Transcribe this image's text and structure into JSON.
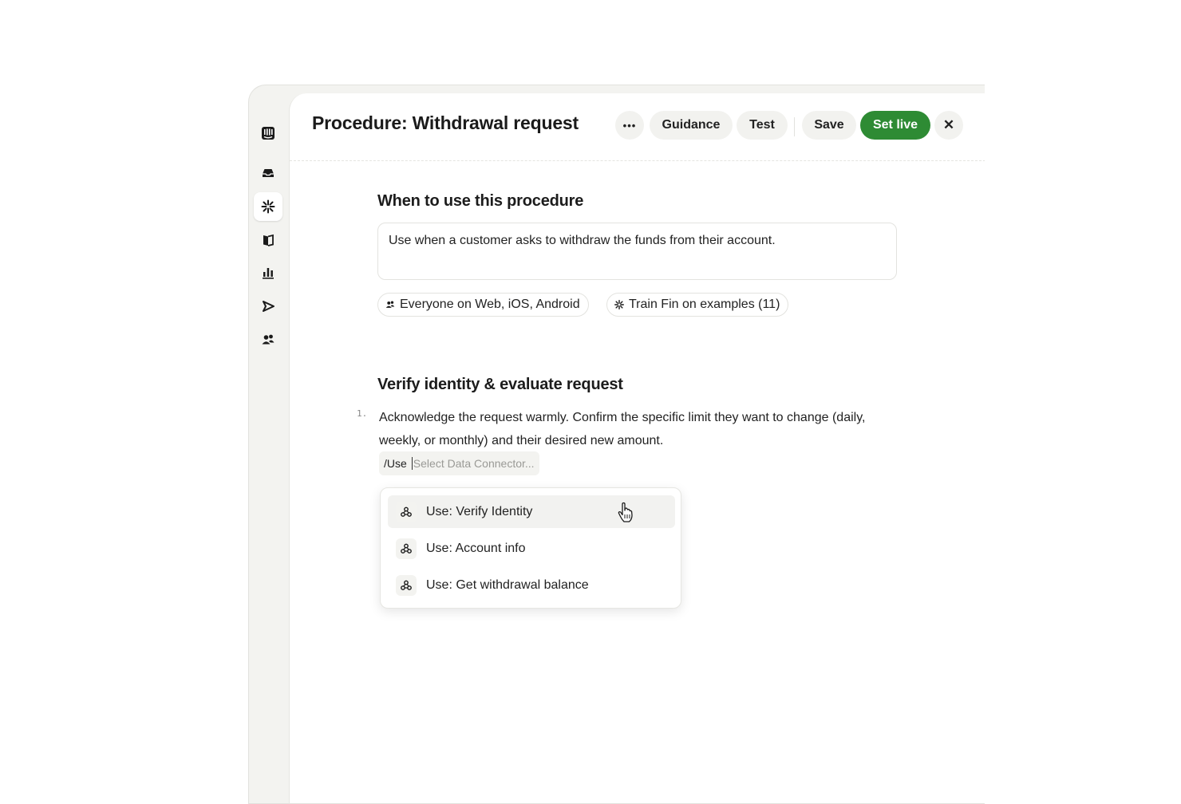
{
  "header": {
    "title": "Procedure: Withdrawal request",
    "more_label": "•••",
    "guidance_label": "Guidance",
    "test_label": "Test",
    "save_label": "Save",
    "set_live_label": "Set live",
    "close_label": "✕"
  },
  "sidebar": {
    "items": [
      {
        "icon": "intercom-logo-icon",
        "active": false
      },
      {
        "icon": "inbox-icon",
        "active": false
      },
      {
        "icon": "fin-ai-icon",
        "active": true
      },
      {
        "icon": "knowledge-book-icon",
        "active": false
      },
      {
        "icon": "reports-icon",
        "active": false
      },
      {
        "icon": "outbound-send-icon",
        "active": false
      },
      {
        "icon": "contacts-icon",
        "active": false
      }
    ]
  },
  "when_section": {
    "title": "When to use this procedure",
    "description": "Use when a customer asks to withdraw the funds from their account.",
    "audience_chip": "Everyone on Web, iOS, Android",
    "train_chip": "Train Fin on examples (11)"
  },
  "verify_section": {
    "title": "Verify identity & evaluate request",
    "steps": [
      {
        "number": "1.",
        "text": "Acknowledge the request warmly. Confirm the specific limit they want to change (daily, weekly, or monthly) and their desired new amount."
      }
    ],
    "command": {
      "prefix": "/Use",
      "placeholder": "Select Data Connector..."
    },
    "connector_options": [
      {
        "label": "Use: Verify Identity",
        "icon": "data-connector-icon",
        "highlighted": true
      },
      {
        "label": "Use: Account info",
        "icon": "data-connector-icon",
        "highlighted": false
      },
      {
        "label": "Use: Get withdrawal balance",
        "icon": "data-connector-icon",
        "highlighted": false
      }
    ]
  },
  "colors": {
    "accent_green": "#2e8b34",
    "rail_bg": "#f3f3f0",
    "pill_bg": "#f2f2ef"
  }
}
